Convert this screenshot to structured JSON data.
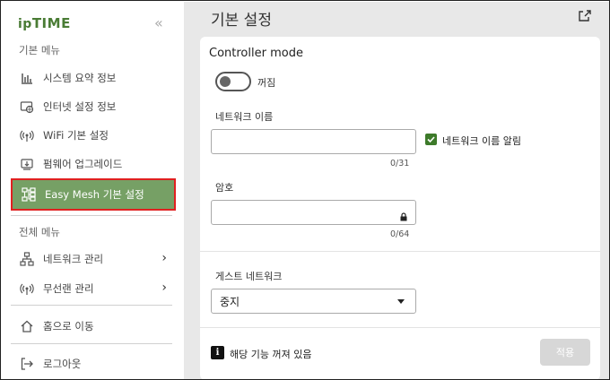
{
  "sidebar": {
    "logo": {
      "ip": "ip",
      "time": "TIME"
    },
    "collapse_glyph": "«",
    "section_basic": "기본 메뉴",
    "basic_items": [
      {
        "label": "시스템 요약 정보",
        "icon": "bar-chart-icon"
      },
      {
        "label": "인터넷 설정 정보",
        "icon": "globe-icon"
      },
      {
        "label": "WiFi 기본 설정",
        "icon": "wifi-icon"
      },
      {
        "label": "펌웨어 업그레이드",
        "icon": "firmware-icon"
      },
      {
        "label": "Easy Mesh 기본 설정",
        "icon": "mesh-icon",
        "active": true
      }
    ],
    "section_all": "전체 메뉴",
    "all_items": [
      {
        "label": "네트워크 관리",
        "icon": "network-icon",
        "expandable": true
      },
      {
        "label": "무선랜 관리",
        "icon": "wireless-icon",
        "expandable": true
      }
    ],
    "home": "홈으로 이동",
    "logout": "로그아웃"
  },
  "main": {
    "title": "기본 설정",
    "controller_mode": {
      "label": "Controller mode",
      "toggle_state": "꺼짐"
    },
    "network_name": {
      "label": "네트워크 이름",
      "value": "",
      "counter": "0/31",
      "broadcast_label": "네트워크 이름 알림",
      "broadcast_checked": true
    },
    "password": {
      "label": "암호",
      "value": "",
      "counter": "0/64"
    },
    "guest_network": {
      "label": "게스트 네트워크",
      "selected": "중지"
    },
    "footer": {
      "info_glyph": "i",
      "info_text": "해당 기능 꺼져 있음",
      "apply_label": "적용"
    }
  },
  "colors": {
    "brand_green": "#4a7c35",
    "active_item_bg": "#76a065",
    "highlight_border": "#e02020",
    "checkbox_green": "#3d7a2a",
    "apply_disabled": "#d7d7d7"
  }
}
